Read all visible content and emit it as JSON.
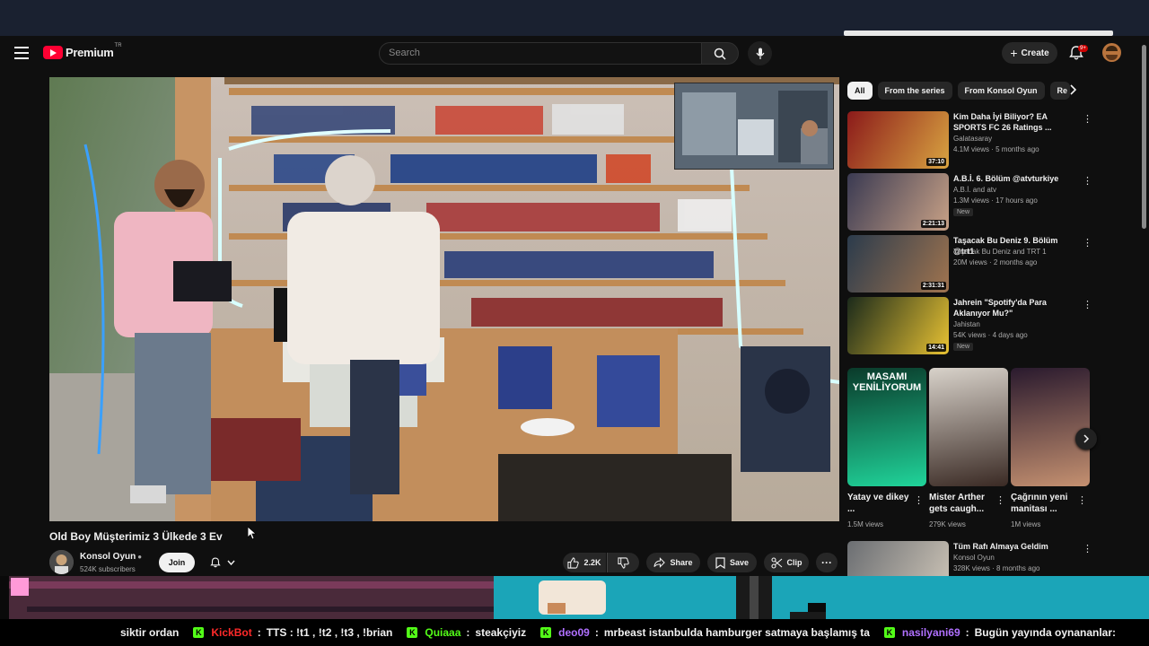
{
  "masthead": {
    "logo_text": "Premium",
    "logo_region": "TR",
    "search_placeholder": "Search",
    "create_label": "Create",
    "notification_count": "9+"
  },
  "video": {
    "title": "Old Boy Müşterimiz 3 Ülkede 3 Ev",
    "channel": "Konsol Oyun",
    "subscribers": "524K subscribers",
    "join_label": "Join",
    "like_count": "2.2K",
    "share_label": "Share",
    "save_label": "Save",
    "clip_label": "Clip",
    "more_label": "···"
  },
  "chips": [
    {
      "label": "All",
      "active": true
    },
    {
      "label": "From the series",
      "active": false
    },
    {
      "label": "From Konsol Oyun",
      "active": false
    },
    {
      "label": "Re",
      "active": false
    }
  ],
  "recommendations": [
    {
      "title": "Kim Daha İyi Biliyor? EA SPORTS FC 26 Ratings ...",
      "channel": "Galatasaray",
      "meta": "4.1M views · 5 months ago",
      "duration": "37:10",
      "badge": "",
      "colors": [
        "#8b1a1a",
        "#d9a441"
      ]
    },
    {
      "title": "A.B.İ. 6. Bölüm @atvturkiye",
      "channel": "A.B.İ. and atv",
      "meta": "1.3M views · 17 hours ago",
      "duration": "2:21:13",
      "badge": "New",
      "colors": [
        "#3a3a52",
        "#c8a186"
      ]
    },
    {
      "title": "Taşacak Bu Deniz 9. Bölüm @trt1",
      "channel": "Taşacak Bu Deniz and TRT 1",
      "meta": "20M views · 2 months ago",
      "duration": "2:31:31",
      "badge": "",
      "colors": [
        "#2b3b4c",
        "#a0744f"
      ]
    },
    {
      "title": "Jahrein \"Spotify'da Para Aklanıyor Mu?\"",
      "channel": "Jahistan",
      "meta": "54K views · 4 days ago",
      "duration": "14:41",
      "badge": "New",
      "colors": [
        "#1b2a1b",
        "#e8c233"
      ]
    },
    {
      "title": "Tüm Rafı Almaya Geldim",
      "channel": "Konsol Oyun",
      "meta": "328K views · 8 months ago",
      "duration": "",
      "badge": "",
      "colors": [
        "#6b6e72",
        "#cfc6b8"
      ]
    }
  ],
  "shorts": [
    {
      "title": "Yatay ve dikey ...",
      "views": "1.5M views",
      "colors": [
        "#0a3a2a",
        "#20d49a"
      ],
      "overlay": "MASAMI YENİLİYORUM"
    },
    {
      "title": "Mister Arther gets caugh...",
      "views": "279K views",
      "colors": [
        "#d8d2ca",
        "#3a2a24"
      ],
      "overlay": ""
    },
    {
      "title": "Çağrının yeni manitası ...",
      "views": "1M views",
      "colors": [
        "#2a1a2e",
        "#c49070"
      ],
      "overlay": ""
    }
  ],
  "chat": [
    {
      "user": "",
      "text": "siktir ordan",
      "color": "#ffffff"
    },
    {
      "user": "KickBot",
      "text": "TTS : !t1 , !t2 , !t3 , !brian",
      "color": "#ff2a2a"
    },
    {
      "user": "Quiaaa",
      "text": "steakçiyiz",
      "color": "#53fc18"
    },
    {
      "user": "deo09",
      "text": "mrbeast istanbulda hamburger satmaya başlamış ta",
      "color": "#b070ff"
    },
    {
      "user": "nasilyani69",
      "text": "Bugün yayında oynananlar:",
      "color": "#b070ff"
    }
  ],
  "colors": {
    "accent": "#ff0033",
    "background": "#0f0f0f",
    "chip_active": "#f1f1f1",
    "kick_green": "#53fc18"
  }
}
